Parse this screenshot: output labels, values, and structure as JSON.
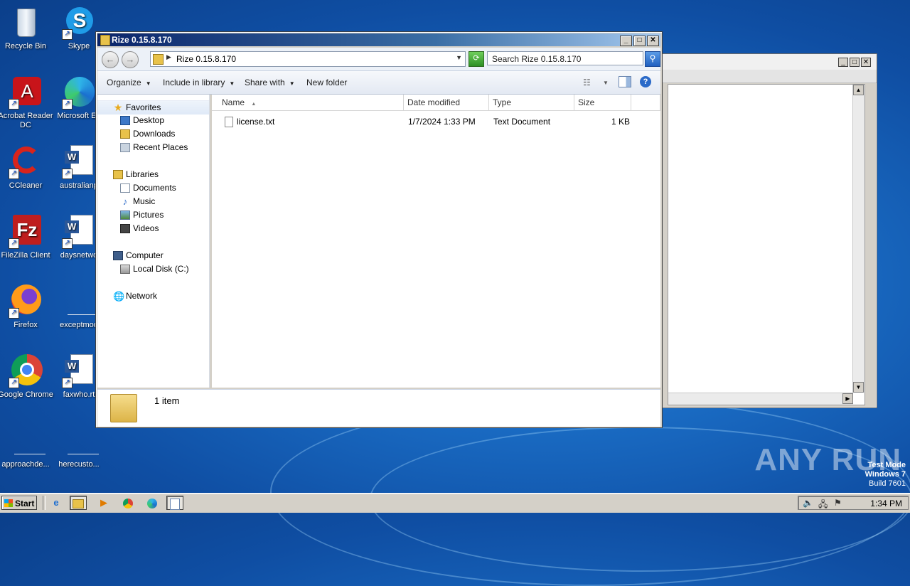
{
  "desktop": {
    "icons": [
      {
        "label": "Recycle Bin"
      },
      {
        "label": "Skype"
      },
      {
        "label": "Acrobat Reader DC"
      },
      {
        "label": "Microsoft Ed"
      },
      {
        "label": "CCleaner"
      },
      {
        "label": "australianp"
      },
      {
        "label": "FileZilla Client"
      },
      {
        "label": "daysnetwo"
      },
      {
        "label": "Firefox"
      },
      {
        "label": "exceptmod"
      },
      {
        "label": "Google Chrome"
      },
      {
        "label": "faxwho.rt"
      },
      {
        "label": "approachde..."
      },
      {
        "label": "herecusto..."
      }
    ],
    "watermark": "ANY RUN",
    "test_mode": {
      "line1": "Test Mode",
      "line2": "Windows 7",
      "line3": "Build 7601"
    }
  },
  "explorer": {
    "title": "Rize 0.15.8.170",
    "address_path": "Rize 0.15.8.170",
    "search_placeholder": "Search Rize 0.15.8.170",
    "toolbar": {
      "organize": "Organize",
      "include_in_library": "Include in library",
      "share_with": "Share with",
      "new_folder": "New folder"
    },
    "nav": {
      "favorites": "Favorites",
      "desktop": "Desktop",
      "downloads": "Downloads",
      "recent_places": "Recent Places",
      "libraries": "Libraries",
      "documents": "Documents",
      "music": "Music",
      "pictures": "Pictures",
      "videos": "Videos",
      "computer": "Computer",
      "local_disk": "Local Disk (C:)",
      "network": "Network"
    },
    "columns": {
      "name": "Name",
      "date_modified": "Date modified",
      "type": "Type",
      "size": "Size"
    },
    "files": [
      {
        "name": "license.txt",
        "date_modified": "1/7/2024 1:33 PM",
        "type": "Text Document",
        "size": "1 KB"
      }
    ],
    "status": "1 item"
  },
  "taskbar": {
    "start_label": "Start",
    "clock": "1:34 PM"
  }
}
